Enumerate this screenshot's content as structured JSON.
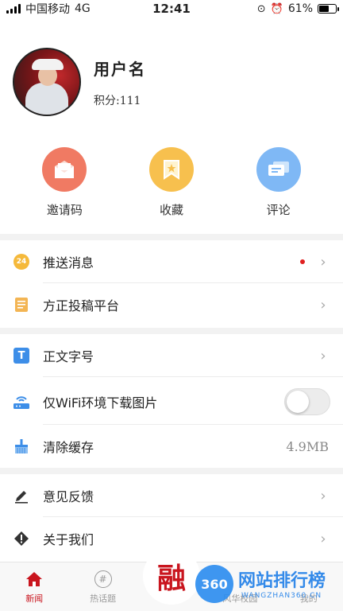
{
  "status_bar": {
    "carrier": "中国移动",
    "network": "4G",
    "time": "12:41",
    "battery": "61%",
    "battery_level": 0.61
  },
  "profile": {
    "username": "用户名",
    "points": "积分:111"
  },
  "actions": [
    {
      "label": "邀请码",
      "icon": "envelope-icon",
      "color": "#f07a63"
    },
    {
      "label": "收藏",
      "icon": "bookmark-icon",
      "color": "#f7c04e"
    },
    {
      "label": "评论",
      "icon": "comment-icon",
      "color": "#7fb8f5"
    }
  ],
  "menu": {
    "push": {
      "label": "推送消息",
      "icon_text": "24"
    },
    "submit": {
      "label": "方正投稿平台"
    },
    "font_size": {
      "label": "正文字号",
      "icon_text": "T"
    },
    "wifi_images": {
      "label": "仅WiFi环境下载图片",
      "enabled": false
    },
    "clear_cache": {
      "label": "清除缓存",
      "value": "4.9MB"
    },
    "feedback": {
      "label": "意见反馈"
    },
    "about": {
      "label": "关于我们"
    }
  },
  "tabbar": {
    "items": [
      {
        "label": "新闻",
        "active": true
      },
      {
        "label": "热话题",
        "icon_text": "#"
      },
      {
        "label": "风华校园"
      },
      {
        "label": "我的"
      }
    ],
    "center_label": "融"
  },
  "watermark": {
    "badge": "360",
    "title": "网站排行榜",
    "subtitle": "WANGZHAN360.CN"
  },
  "colors": {
    "brand_red": "#c9151e",
    "dot_red": "#e02020"
  }
}
